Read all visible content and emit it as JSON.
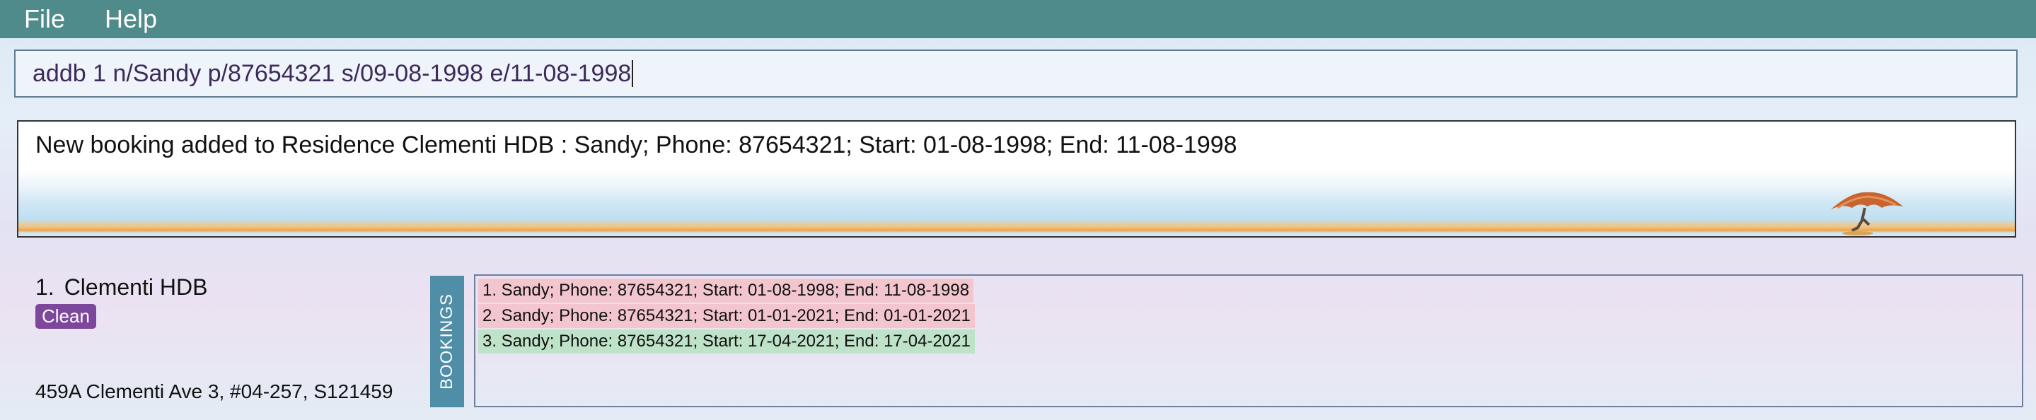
{
  "menu": {
    "items": [
      "File",
      "Help"
    ]
  },
  "command": {
    "value": "addb 1 n/Sandy p/87654321 s/09-08-1998 e/11-08-1998"
  },
  "result": {
    "message": "New booking added to Residence Clementi HDB : Sandy; Phone: 87654321; Start: 01-08-1998; End: 11-08-1998"
  },
  "residence": {
    "index": "1.",
    "name": "Clementi HDB",
    "tag": "Clean",
    "address": "459A Clementi Ave 3, #04-257, S121459",
    "bookings_label": "BOOKINGS",
    "bookings": [
      {
        "text": "1. Sandy; Phone: 87654321; Start: 01-08-1998; End: 11-08-1998",
        "status": "past"
      },
      {
        "text": "2. Sandy; Phone: 87654321; Start: 01-01-2021; End: 01-01-2021",
        "status": "past"
      },
      {
        "text": "3. Sandy; Phone: 87654321; Start: 17-04-2021; End: 17-04-2021",
        "status": "upcoming"
      }
    ]
  },
  "colors": {
    "menubar": "#508b8b",
    "tag": "#7d479b",
    "bookings_label": "#4f8ea6",
    "booking_past": "#f3c6cf",
    "booking_upcoming": "#bfe3c8"
  }
}
